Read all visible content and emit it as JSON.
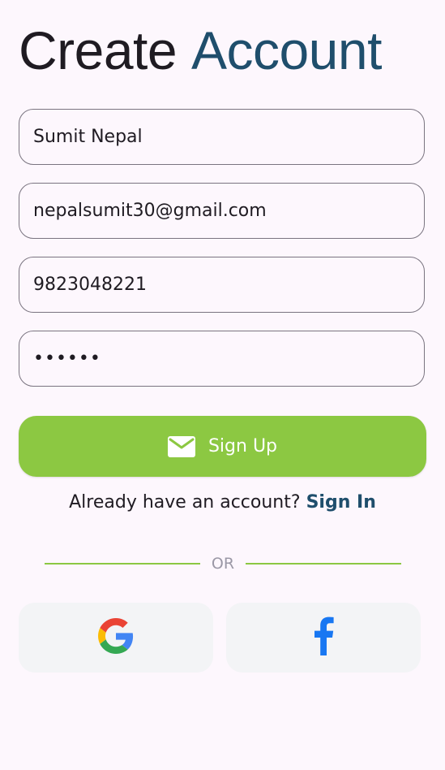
{
  "header": {
    "title_part1": "Create",
    "title_part2": "Account"
  },
  "form": {
    "name_value": "Sumit Nepal",
    "email_value": "nepalsumit30@gmail.com",
    "phone_value": "9823048221",
    "password_value": "••••••"
  },
  "signup_button": {
    "label": "Sign Up",
    "icon": "mail-icon"
  },
  "signin_prompt": {
    "text": "Already have an account?",
    "link_label": "Sign In"
  },
  "divider": {
    "label": "OR"
  },
  "social": {
    "google_icon": "google-icon",
    "facebook_icon": "facebook-icon"
  },
  "colors": {
    "accent": "#1f4e6c",
    "primary_button": "#8cc842",
    "background": "#fdf7fd",
    "social_bg": "#f3f4f6",
    "facebook_blue": "#1877f2"
  }
}
